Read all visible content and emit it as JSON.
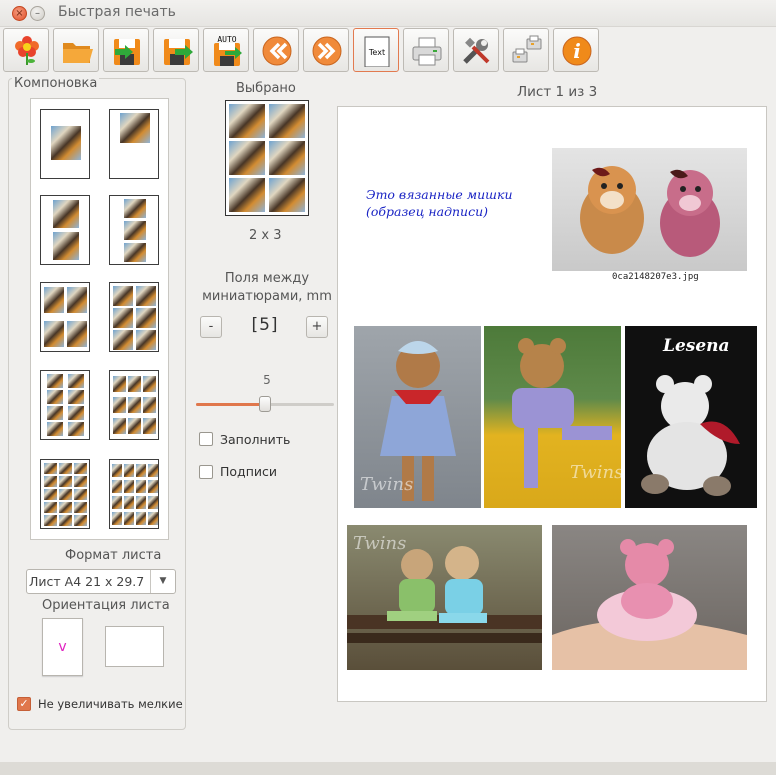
{
  "window": {
    "title": "Быстрая печать",
    "close_glyph": "×",
    "minimize_glyph": "–"
  },
  "toolbar": {
    "buttons": [
      {
        "name": "flower-icon"
      },
      {
        "name": "folder-icon"
      },
      {
        "name": "save-in-icon"
      },
      {
        "name": "save-out-icon"
      },
      {
        "name": "auto-save-icon",
        "text": "AUTO"
      },
      {
        "name": "previous-icon"
      },
      {
        "name": "next-icon"
      },
      {
        "name": "text-icon",
        "text": "Text"
      },
      {
        "name": "printer-icon"
      },
      {
        "name": "tools-icon"
      },
      {
        "name": "printer-network-icon"
      },
      {
        "name": "info-icon",
        "text": "i"
      }
    ]
  },
  "layout_panel": {
    "title": "Компоновка",
    "format_label": "Формат листа",
    "format_value": "Лист А4 21 x 29.7",
    "format_arrow": "▼",
    "orientation_label": "Ориентация листа",
    "portrait_mark": "v",
    "no_enlarge_label": "Не увеличивать мелкие",
    "no_enlarge_checked": true,
    "no_enlarge_mark": "✓"
  },
  "selection": {
    "label": "Выбрано",
    "grid": "2 x 3",
    "spacing_label": "Поля между миниатюрами, mm",
    "minus": "-",
    "plus": "+",
    "spacing_value": "[5]",
    "slider_value": "5",
    "slider_fraction": 0.5,
    "fill_label": "Заполнить",
    "fill_checked": false,
    "captions_label": "Подписи",
    "captions_checked": false
  },
  "preview": {
    "page_indicator": "Лист 1 из 3",
    "note_line1": "Это вязанные мишки",
    "note_line2": "(образец надписи)",
    "filename": "0ca2148207e3.jpg",
    "watermark_lesena": "Lesena",
    "watermark_twins": "Twins"
  },
  "colors": {
    "accent": "#e0774c",
    "note_text": "#1a24c4",
    "portrait_mark": "#e020c0"
  }
}
